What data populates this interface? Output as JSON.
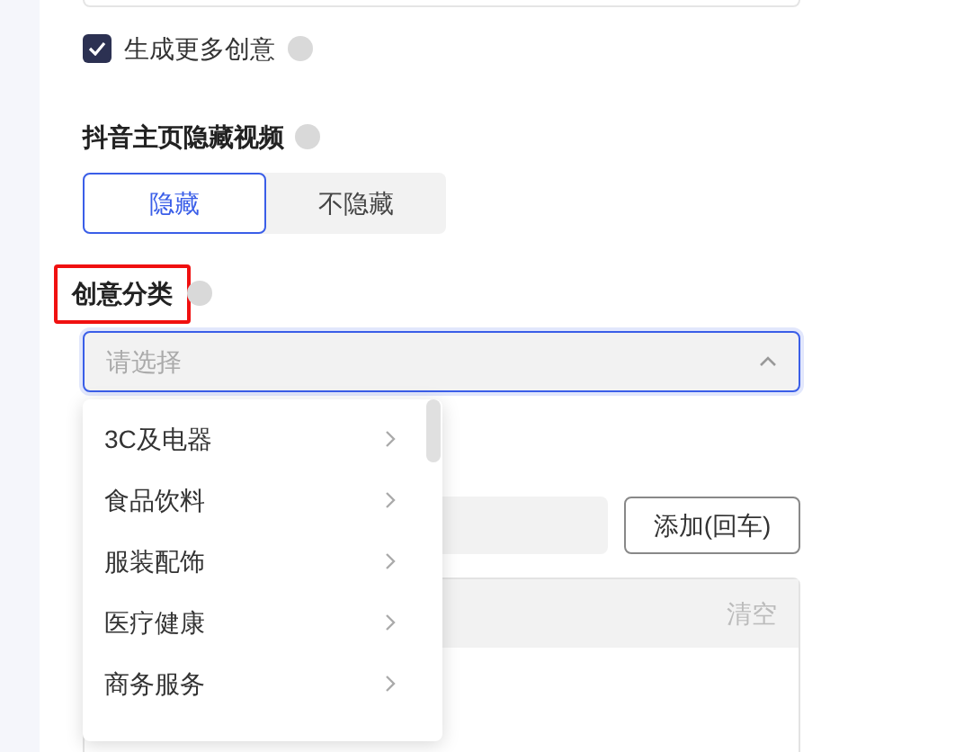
{
  "more_ideas": {
    "label": "生成更多创意",
    "checked": true
  },
  "hide_video": {
    "title": "抖音主页隐藏视频",
    "options": [
      {
        "label": "隐藏",
        "selected": true
      },
      {
        "label": "不隐藏",
        "selected": false
      }
    ]
  },
  "category": {
    "title": "创意分类",
    "highlighted": true,
    "select": {
      "placeholder": "请选择",
      "expanded": true
    },
    "menu": [
      {
        "label": "3C及电器"
      },
      {
        "label": "食品饮料"
      },
      {
        "label": "服装配饰"
      },
      {
        "label": "医疗健康"
      },
      {
        "label": "商务服务"
      }
    ]
  },
  "add_button": "添加(回车)",
  "list_panel": {
    "clear": "清空"
  }
}
